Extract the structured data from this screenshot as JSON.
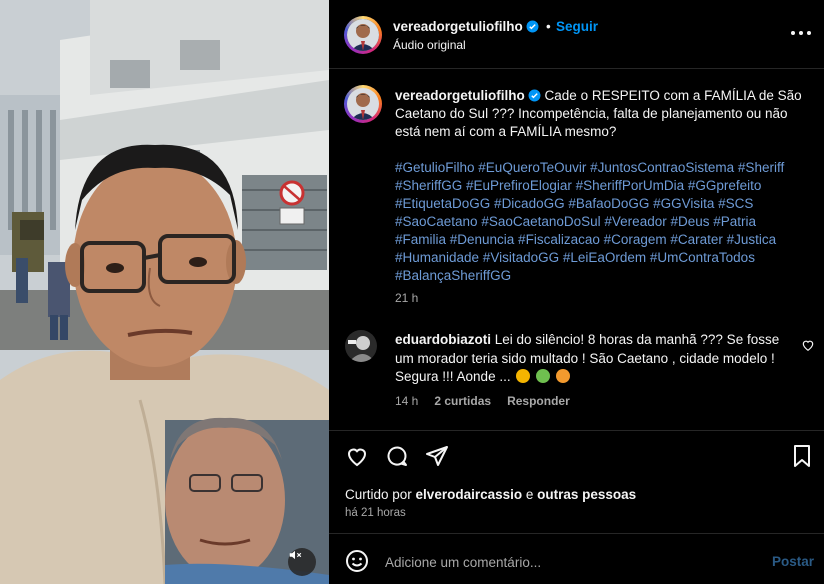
{
  "header": {
    "username": "vereadorgetuliofilho",
    "separator": "•",
    "follow_label": "Seguir",
    "audio_label": "Áudio original",
    "more_icon": "more-horizontal-icon"
  },
  "caption": {
    "username": "vereadorgetuliofilho",
    "text": "Cade o RESPEITO com a FAMÍLIA de São Caetano do Sul ??? Incompetência, falta de planejamento ou não está nem aí com a FAMÍLIA mesmo?",
    "hashtags": "#GetulioFilho #EuQueroTeOuvir #JuntosContraoSistema #Sheriff #SheriffGG #EuPrefiroElogiar #SheriffPorUmDia #GGprefeito #EtiquetaDoGG #DicadoGG #BafaoDoGG #GGVisita #SCS #SaoCaetano #SaoCaetanoDoSul #Vereador #Deus #Patria #Familia #Denuncia #Fiscalizacao #Coragem #Carater #Justica #Humanidade #VisitadoGG #LeiEaOrdem #UmContraTodos #BalançaSheriffGG",
    "time": "21 h"
  },
  "comment": {
    "username": "eduardobiazoti",
    "text": "Lei do silêncio! 8 horas da manhã ??? Se fosse um morador teria sido multado ! São Caetano , cidade modelo ! Segura !!! Aonde ...",
    "emojis": [
      "flushed-face",
      "nauseated-face",
      "crying-face"
    ],
    "time": "14 h",
    "likes_label": "2 curtidas",
    "reply_label": "Responder"
  },
  "actions": {
    "like_icon": "heart-icon",
    "comment_icon": "comment-icon",
    "share_icon": "share-icon",
    "save_icon": "bookmark-icon"
  },
  "likes": {
    "prefix": "Curtido por ",
    "user": "elverodaircassio",
    "conjunction": " e ",
    "others": "outras pessoas"
  },
  "post_time": "há 21 horas",
  "comment_box": {
    "placeholder": "Adicione um comentário...",
    "post_label": "Postar"
  },
  "colors": {
    "link": "#0095f6",
    "hashtag": "#6e9bd6",
    "muted": "#a8a8a8"
  }
}
